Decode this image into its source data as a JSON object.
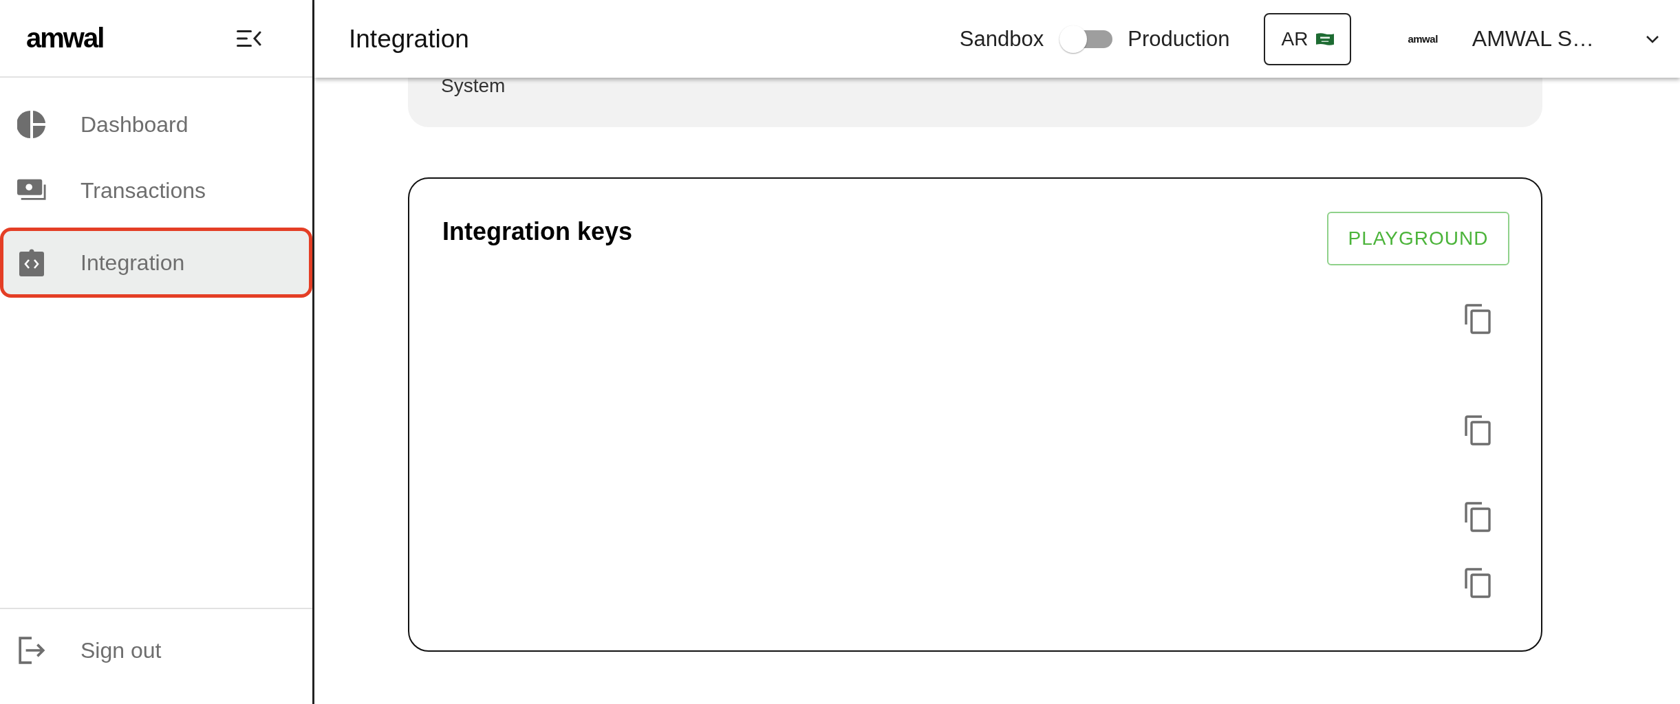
{
  "sidebar": {
    "logo": "amwal",
    "items": [
      {
        "label": "Dashboard",
        "kind": "pie",
        "selected": false
      },
      {
        "label": "Transactions",
        "kind": "money",
        "selected": false
      },
      {
        "label": "Integration",
        "kind": "code",
        "selected": true
      }
    ],
    "footer_item": {
      "label": "Sign out",
      "kind": "signout"
    }
  },
  "header": {
    "title": "Integration",
    "env_toggle": {
      "left_label": "Sandbox",
      "right_label": "Production",
      "on": false
    },
    "language_button": "AR",
    "account": {
      "logo": "amwal",
      "name": "AMWAL S…"
    }
  },
  "system_card": {
    "label": "System"
  },
  "keys_card": {
    "title": "Integration keys",
    "button": "PLAYGROUND",
    "keys": [
      {
        "kind": "copy"
      },
      {
        "kind": "copy"
      },
      {
        "kind": "copy"
      },
      {
        "kind": "copy"
      }
    ]
  }
}
